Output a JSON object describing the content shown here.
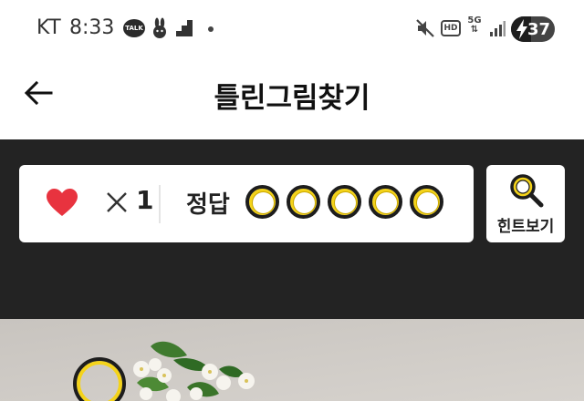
{
  "status_bar": {
    "carrier": "KT",
    "time": "8:33",
    "talk_badge": "TALK",
    "battery": "37",
    "network": "5G",
    "hd": "HD",
    "icons": [
      "kakaotalk-icon",
      "rabbit-icon",
      "stairs-icon",
      "dot-icon",
      "mute-icon",
      "hd-icon",
      "5g-icon",
      "signal-icon",
      "battery-charging-icon"
    ]
  },
  "header": {
    "title": "틀린그림찾기",
    "back_icon": "arrow-left-icon"
  },
  "game": {
    "lives": {
      "icon": "heart-icon",
      "multiplier_icon": "times-icon",
      "count": "1"
    },
    "answer_label": "정답",
    "answer_slots": {
      "total": 5,
      "found": 0
    },
    "hint": {
      "label": "힌트보기",
      "icon": "magnifier-icon"
    }
  },
  "colors": {
    "dark_background": "#232323",
    "accent_yellow": "#f4d31a",
    "heart_red": "#e8333f"
  }
}
